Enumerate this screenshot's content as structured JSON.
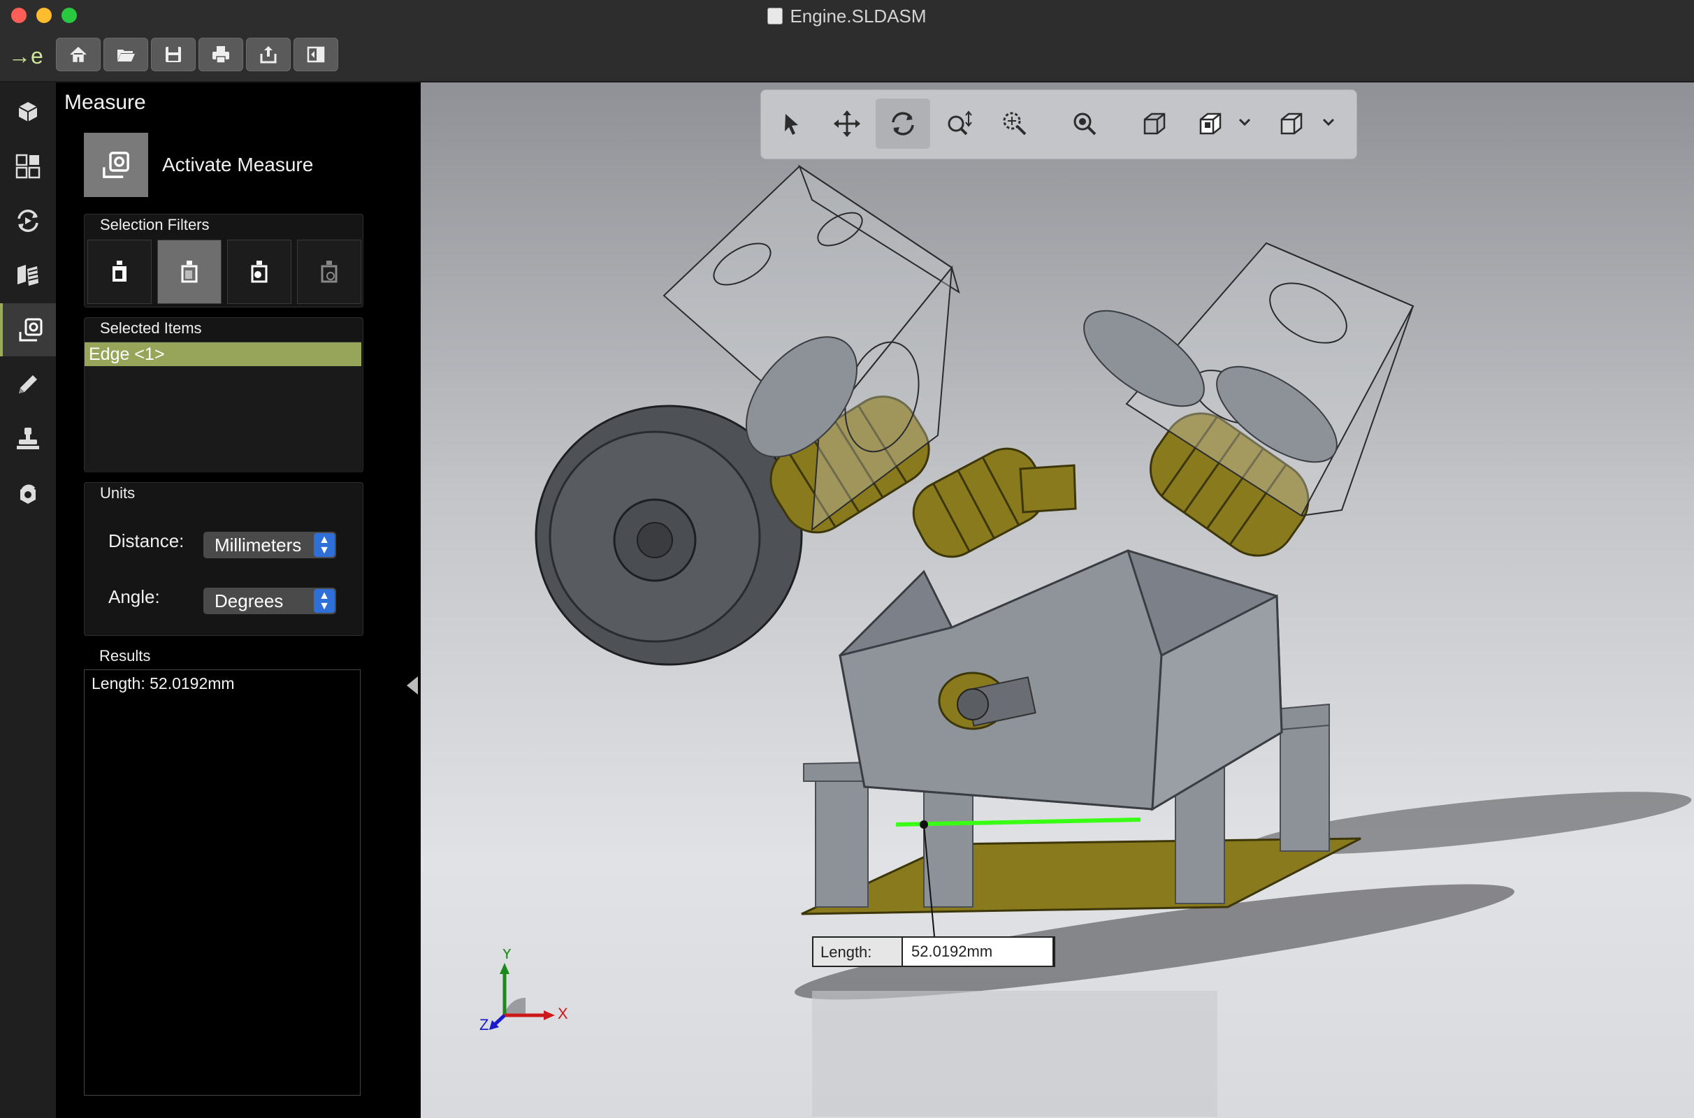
{
  "window": {
    "title": "Engine.SLDASM",
    "logo": "→e"
  },
  "toolbar": {
    "buttons": [
      {
        "name": "home-icon"
      },
      {
        "name": "folder-open-icon"
      },
      {
        "name": "save-icon"
      },
      {
        "name": "print-icon"
      },
      {
        "name": "share-icon"
      },
      {
        "name": "panel-toggle-icon"
      }
    ]
  },
  "iconbar": {
    "items": [
      {
        "name": "model-tree-icon"
      },
      {
        "name": "configurations-icon"
      },
      {
        "name": "animation-icon"
      },
      {
        "name": "explode-icon"
      },
      {
        "name": "measure-icon",
        "active": true
      },
      {
        "name": "markup-pen-icon"
      },
      {
        "name": "stamp-icon"
      },
      {
        "name": "section-icon"
      }
    ]
  },
  "panel": {
    "title": "Measure",
    "activate_label": "Activate Measure",
    "selection_filters": {
      "label": "Selection Filters",
      "filters": [
        {
          "name": "filter-face-icon",
          "active": false
        },
        {
          "name": "filter-edge-icon",
          "active": true
        },
        {
          "name": "filter-vertex-icon",
          "active": false
        },
        {
          "name": "filter-point-icon",
          "active": false
        }
      ]
    },
    "selected_items": {
      "label": "Selected Items",
      "items": [
        "Edge <1>"
      ]
    },
    "units": {
      "label": "Units",
      "distance_label": "Distance:",
      "distance_value": "Millimeters",
      "angle_label": "Angle:",
      "angle_value": "Degrees"
    },
    "results": {
      "label": "Results",
      "text": "Length: 52.0192mm"
    }
  },
  "viewport": {
    "tools": [
      {
        "name": "select-icon"
      },
      {
        "name": "pan-icon"
      },
      {
        "name": "rotate-icon",
        "active": true
      },
      {
        "name": "zoom-icon"
      },
      {
        "name": "zoom-area-icon"
      },
      {
        "name": "zoom-fit-icon"
      },
      {
        "name": "view-orientation-icon"
      },
      {
        "name": "display-style-icon"
      },
      {
        "name": "section-view-icon"
      }
    ],
    "measure_callout": {
      "key": "Length:",
      "value": "52.0192mm"
    },
    "triad": {
      "x": "X",
      "y": "Y",
      "z": "Z"
    },
    "colors": {
      "selected_edge": "#39ff14",
      "accent": "#96a55a",
      "brass": "#8a7a1e"
    }
  }
}
